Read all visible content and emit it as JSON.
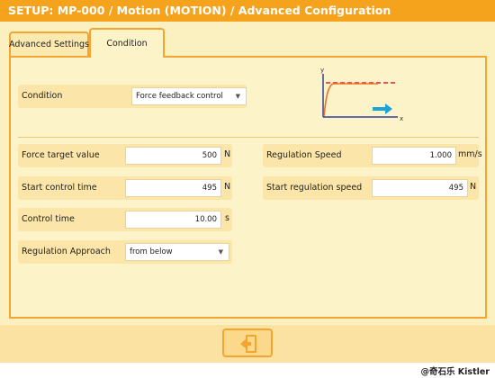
{
  "title": "SETUP: MP-000 / Motion (MOTION)  / Advanced Configuration",
  "tabs": [
    {
      "label": "Advanced Settings",
      "active": false
    },
    {
      "label": "Condition",
      "active": true
    }
  ],
  "condition": {
    "label": "Condition",
    "value": "Force feedback control",
    "graph": {
      "y_axis": "y",
      "x_axis": "x"
    }
  },
  "left_fields": [
    {
      "label": "Force target value",
      "value": "500",
      "unit": "N"
    },
    {
      "label": "Start control time",
      "value": "495",
      "unit": "N"
    },
    {
      "label": "Control time",
      "value": "10.00",
      "unit": "s"
    }
  ],
  "regulation_approach": {
    "label": "Regulation Approach",
    "value": "from below"
  },
  "right_fields": [
    {
      "label": "Regulation Speed",
      "value": "1.000",
      "unit": "mm/s"
    },
    {
      "label": "Start regulation speed",
      "value": "495",
      "unit": "N"
    }
  ],
  "footer": {
    "exit_icon": "exit-icon"
  },
  "watermark": "@奇石乐 Kistler",
  "colors": {
    "accent": "#f5a21c",
    "panel": "#fdf3c8",
    "row": "#fbe5a8",
    "graph_line": "#e9722d",
    "graph_target": "#d62828",
    "graph_axis": "#2f3f9a",
    "graph_arrow": "#1aa3d9"
  }
}
